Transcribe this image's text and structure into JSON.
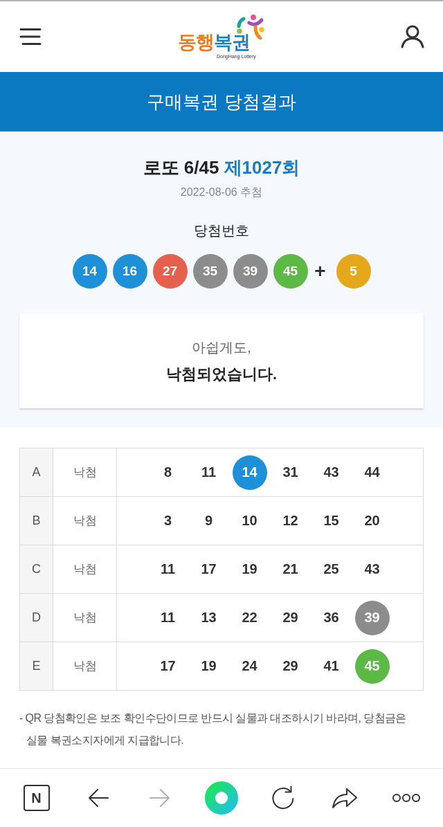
{
  "header": {
    "logo": {
      "words": [
        {
          "text": "동행",
          "color": "#ea7b1f"
        },
        {
          "text": "복권",
          "color": "#1f7fc5"
        }
      ],
      "tagline": "DongHang Lottery"
    }
  },
  "banner": {
    "title": "구매복권 당첨결과"
  },
  "draw": {
    "game": "로또 6/45",
    "round": "제1027회",
    "date": "2022-08-06 추첨",
    "numbers_label": "당첨번호",
    "winning_numbers": [
      {
        "number": "14",
        "color": "#1e90d8"
      },
      {
        "number": "16",
        "color": "#1e90d8"
      },
      {
        "number": "27",
        "color": "#e6604e"
      },
      {
        "number": "35",
        "color": "#8c8c8c"
      },
      {
        "number": "39",
        "color": "#8c8c8c"
      },
      {
        "number": "45",
        "color": "#5cb946"
      }
    ],
    "plus": "+",
    "bonus_number": {
      "number": "5",
      "color": "#e5a71c"
    }
  },
  "result": {
    "line_1": "아쉽게도,",
    "line_2": "낙첨되었습니다."
  },
  "tickets": [
    {
      "label": "A",
      "result": "낙첨",
      "numbers": [
        {
          "number": "8",
          "matched": false
        },
        {
          "number": "11",
          "matched": false
        },
        {
          "number": "14",
          "matched": true,
          "color": "#1e90d8"
        },
        {
          "number": "31",
          "matched": false
        },
        {
          "number": "43",
          "matched": false
        },
        {
          "number": "44",
          "matched": false
        }
      ]
    },
    {
      "label": "B",
      "result": "낙첨",
      "numbers": [
        {
          "number": "3",
          "matched": false
        },
        {
          "number": "9",
          "matched": false
        },
        {
          "number": "10",
          "matched": false
        },
        {
          "number": "12",
          "matched": false
        },
        {
          "number": "15",
          "matched": false
        },
        {
          "number": "20",
          "matched": false
        }
      ]
    },
    {
      "label": "C",
      "result": "낙첨",
      "numbers": [
        {
          "number": "11",
          "matched": false
        },
        {
          "number": "17",
          "matched": false
        },
        {
          "number": "19",
          "matched": false
        },
        {
          "number": "21",
          "matched": false
        },
        {
          "number": "25",
          "matched": false
        },
        {
          "number": "43",
          "matched": false
        }
      ]
    },
    {
      "label": "D",
      "result": "낙첨",
      "numbers": [
        {
          "number": "11",
          "matched": false
        },
        {
          "number": "13",
          "matched": false
        },
        {
          "number": "22",
          "matched": false
        },
        {
          "number": "29",
          "matched": false
        },
        {
          "number": "36",
          "matched": false
        },
        {
          "number": "39",
          "matched": true,
          "color": "#8c8c8c"
        }
      ]
    },
    {
      "label": "E",
      "result": "낙첨",
      "numbers": [
        {
          "number": "17",
          "matched": false
        },
        {
          "number": "19",
          "matched": false
        },
        {
          "number": "24",
          "matched": false
        },
        {
          "number": "29",
          "matched": false
        },
        {
          "number": "41",
          "matched": false
        },
        {
          "number": "45",
          "matched": true,
          "color": "#5cb946"
        }
      ]
    }
  ],
  "note": "- QR 당첨확인은 보조 확인수단이므로 반드시 실물과 대조하시기 바라며, 당첨금은 실물 복권소지자에게 지급합니다.",
  "toolbar": {
    "items": [
      {
        "kind": "home",
        "label": "N",
        "disabled": false
      },
      {
        "kind": "back",
        "disabled": false
      },
      {
        "kind": "forward",
        "disabled": true
      },
      {
        "kind": "ring",
        "disabled": false
      },
      {
        "kind": "reload",
        "disabled": false
      },
      {
        "kind": "share",
        "disabled": false
      },
      {
        "kind": "more",
        "disabled": false
      }
    ]
  }
}
